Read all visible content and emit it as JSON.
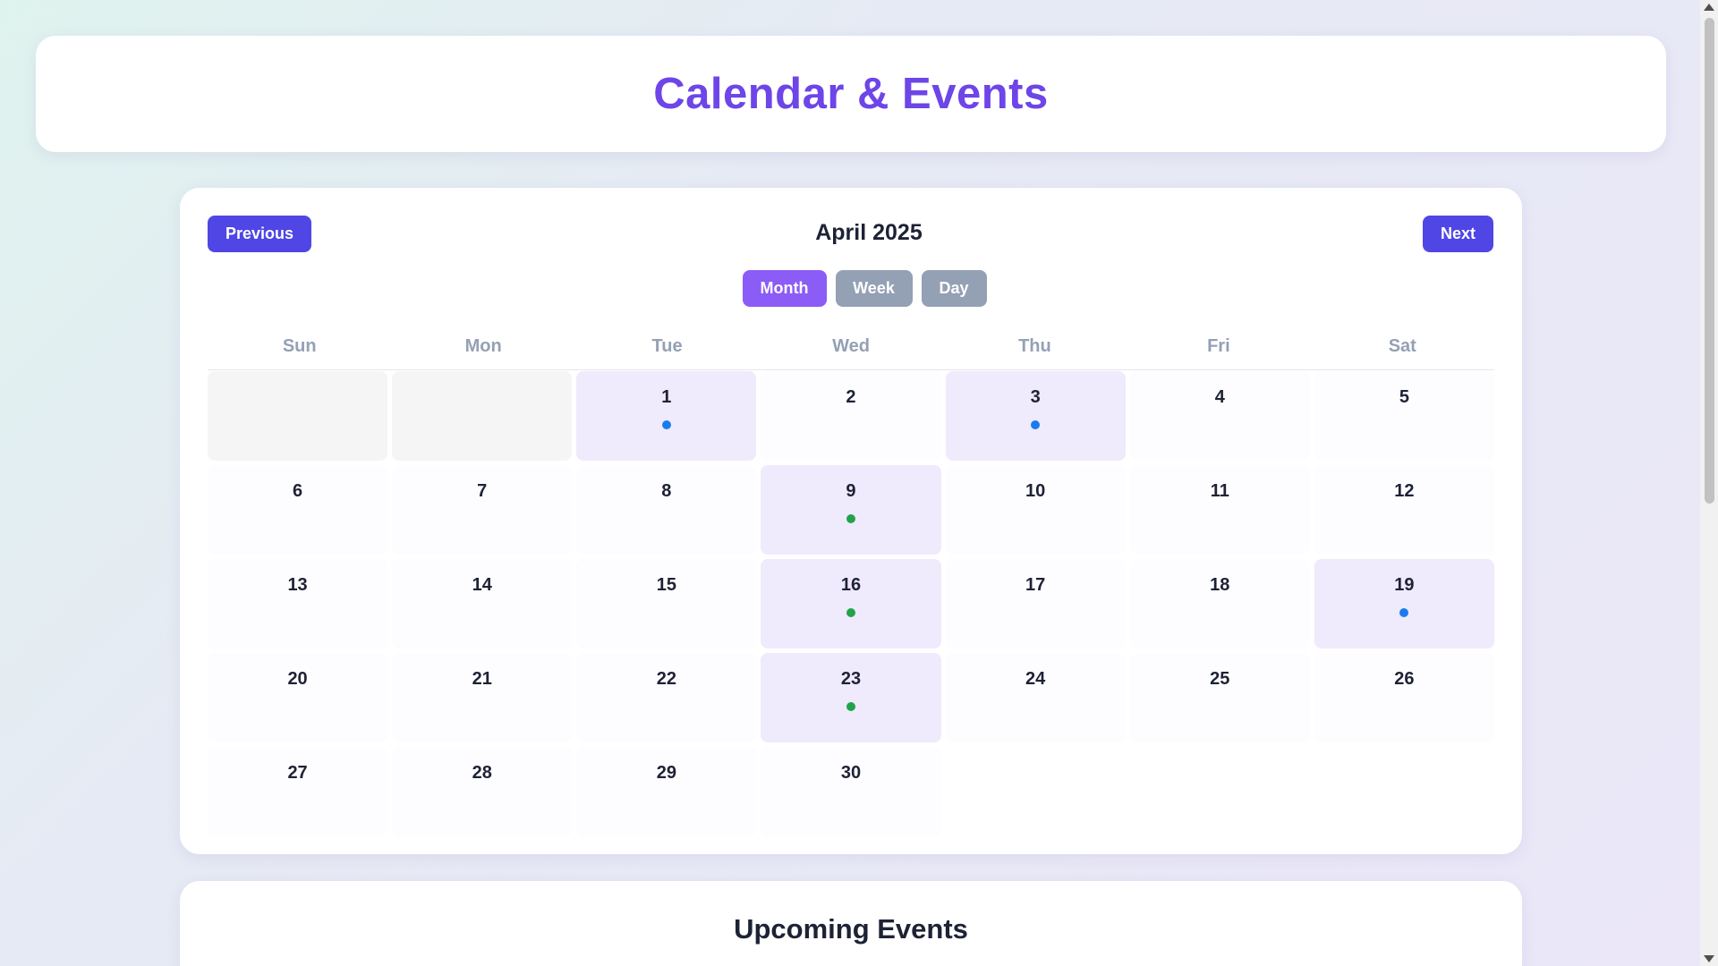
{
  "header": {
    "title": "Calendar & Events"
  },
  "calendar": {
    "month_label": "April 2025",
    "prev_label": "Previous",
    "next_label": "Next",
    "views": [
      {
        "label": "Month",
        "active": true
      },
      {
        "label": "Week",
        "active": false
      },
      {
        "label": "Day",
        "active": false
      }
    ],
    "weekdays": [
      "Sun",
      "Mon",
      "Tue",
      "Wed",
      "Thu",
      "Fri",
      "Sat"
    ],
    "leading_empty_days": 2,
    "days_in_month": 30,
    "event_colors": {
      "blue": "#1a7bf0",
      "green": "#22a34a"
    },
    "events": [
      {
        "day": 1,
        "color": "blue"
      },
      {
        "day": 3,
        "color": "blue"
      },
      {
        "day": 9,
        "color": "green"
      },
      {
        "day": 16,
        "color": "green"
      },
      {
        "day": 19,
        "color": "blue"
      },
      {
        "day": 23,
        "color": "green"
      }
    ]
  },
  "upcoming": {
    "title": "Upcoming Events"
  },
  "colors": {
    "accent": "#6d45e8",
    "primary_button": "#4f46e5",
    "active_view": "#8b5cf6",
    "inactive_view": "#94a0b4"
  }
}
